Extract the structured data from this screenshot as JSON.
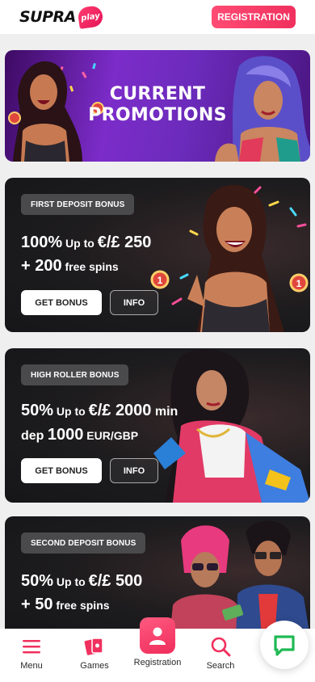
{
  "header": {
    "logo_text": "SUPRA",
    "logo_badge": "play",
    "registration_label": "REGISTRATION"
  },
  "hero": {
    "title_line1": "CURRENT",
    "title_line2": "PROMOTIONS"
  },
  "cards": [
    {
      "tag": "FIRST DEPOSIT BONUS",
      "line1_big": "100%",
      "line1_small": " Up to ",
      "line1_amount": "€/£ 250",
      "line2_prefix": "+ ",
      "line2_big": "200",
      "line2_small": " free spins",
      "get_bonus": "GET BONUS",
      "info": "INFO"
    },
    {
      "tag": "HIGH ROLLER BONUS",
      "line1_big": "50%",
      "line1_small": " Up to ",
      "line1_amount": "€/£ 2000",
      "line1_tail": " min",
      "line2_prefix": "dep ",
      "line2_big": "1000",
      "line2_small": " EUR/GBP",
      "get_bonus": "GET BONUS",
      "info": "INFO"
    },
    {
      "tag": "SECOND DEPOSIT BONUS",
      "line1_big": "50%",
      "line1_small": " Up to ",
      "line1_amount": "€/£ 500",
      "line2_prefix": "+ ",
      "line2_big": "50",
      "line2_small": " free spins"
    }
  ],
  "bottom_nav": {
    "menu": "Menu",
    "games": "Games",
    "registration": "Registration",
    "search": "Search"
  },
  "colors": {
    "accent": "#f0305e",
    "chat": "#1fb955"
  }
}
